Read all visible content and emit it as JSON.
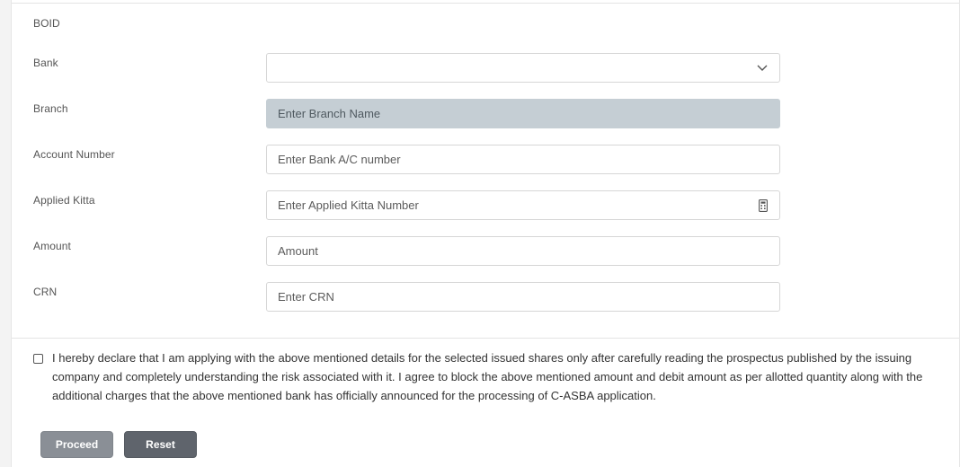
{
  "form": {
    "boid_label": "BOID",
    "bank_label": "Bank",
    "bank_value": "",
    "branch_label": "Branch",
    "branch_placeholder": "Enter Branch Name",
    "account_label": "Account Number",
    "account_placeholder": "Enter Bank A/C number",
    "kitta_label": "Applied Kitta",
    "kitta_placeholder": "Enter Applied Kitta Number",
    "amount_label": "Amount",
    "amount_placeholder": "Amount",
    "crn_label": "CRN",
    "crn_placeholder": "Enter CRN"
  },
  "declaration": {
    "checked": false,
    "text": "I hereby declare that I am applying with the above mentioned details for the selected issued shares only after carefully reading the prospectus published by the issuing company and completely understanding the risk associated with it. I agree to block the above mentioned amount and debit amount as per allotted quantity along with the additional charges that the above mentioned bank has officially announced for the processing of C-ASBA application."
  },
  "buttons": {
    "proceed_label": "Proceed",
    "reset_label": "Reset"
  },
  "colors": {
    "disabled_field": "#c5ced4",
    "proceed_button": "#8a8f96",
    "reset_button": "#5f646c"
  },
  "icons": {
    "bank_dropdown": "chevron-down-icon",
    "kitta_field": "calculator-icon"
  }
}
